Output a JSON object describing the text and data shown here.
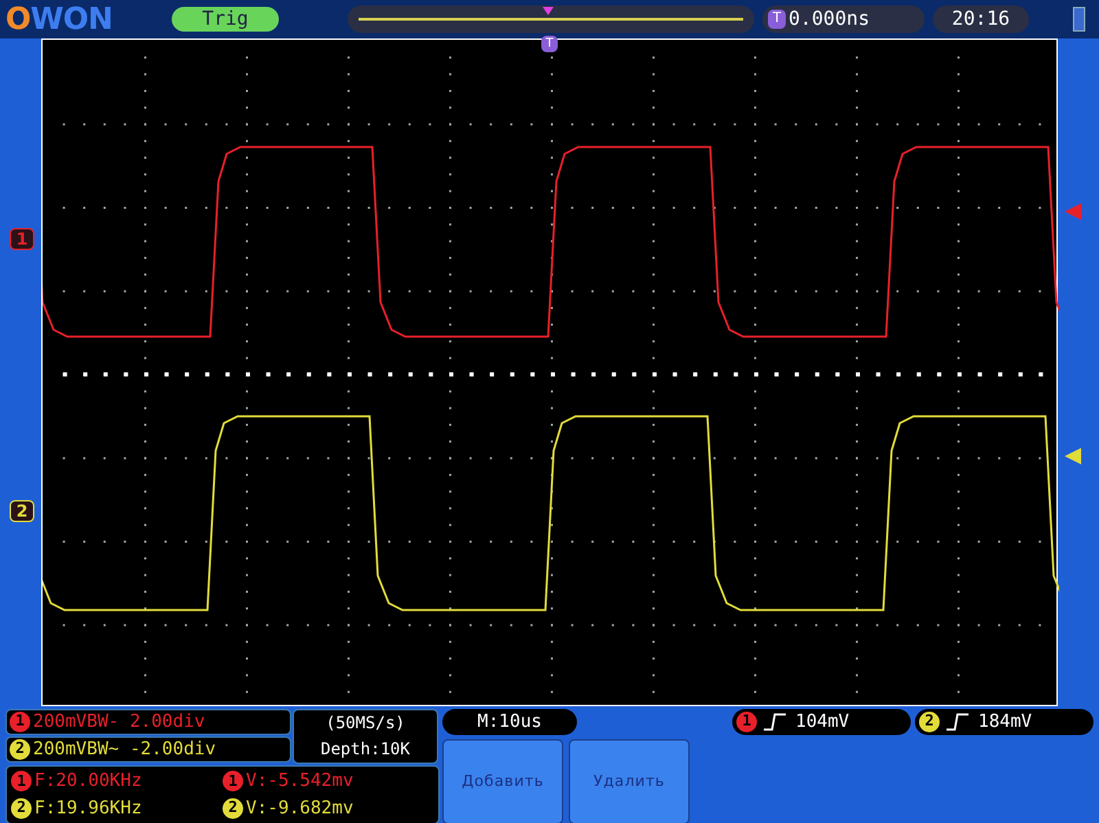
{
  "brand": "OWON",
  "trigger_status": "Trig",
  "time_badge": "T",
  "trigger_time": "0.000ns",
  "clock": "20:16",
  "trigger_marker": "T",
  "channels": [
    {
      "color": "#e8202a",
      "side_marker": "1",
      "scale_badge": "1",
      "scale": "200mVBW- 2.00div",
      "frequency_badge": "1",
      "frequency": "F:20.00KHz",
      "voltage_badge": "1",
      "voltage": "V:-5.542mv",
      "trigger_badge": "1",
      "trigger_level": "104mV"
    },
    {
      "color": "#e2dc3a",
      "side_marker": "2",
      "scale_badge": "2",
      "scale": "200mVBW~ -2.00div",
      "frequency_badge": "2",
      "frequency": "F:19.96KHz",
      "voltage_badge": "2",
      "voltage": "V:-9.682mv",
      "trigger_badge": "2",
      "trigger_level": "184mV"
    }
  ],
  "sample_rate": "(50MS/s)",
  "depth": "Depth:10K",
  "timebase": "M:10us",
  "buttons": [
    "Добавить",
    "Удалить"
  ]
}
